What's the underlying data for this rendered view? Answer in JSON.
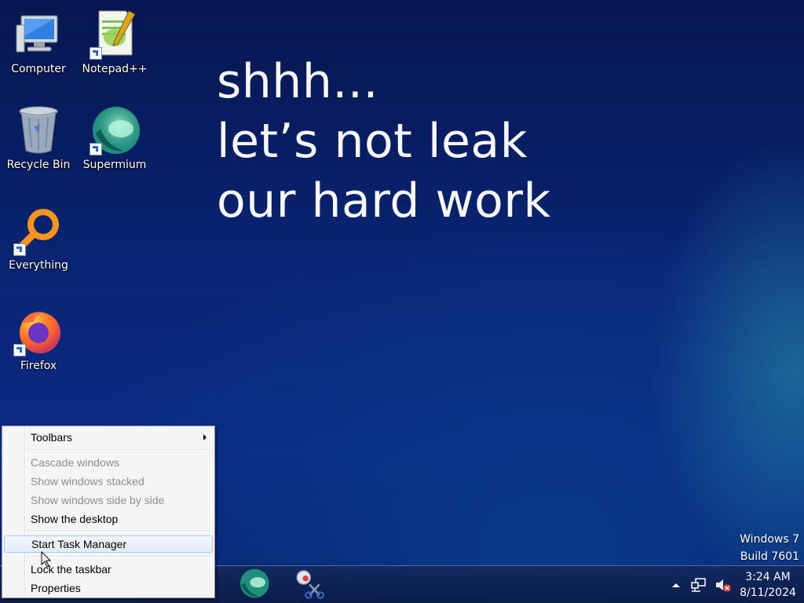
{
  "desktop": {
    "icons": [
      {
        "label": "Computer",
        "icon": "computer-icon",
        "shortcut": false
      },
      {
        "label": "Notepad++",
        "icon": "notepadpp-icon",
        "shortcut": true
      },
      {
        "label": "Recycle Bin",
        "icon": "recycle-bin-icon",
        "shortcut": false
      },
      {
        "label": "Supermium",
        "icon": "supermium-icon",
        "shortcut": true
      },
      {
        "label": "Everything",
        "icon": "everything-search-icon",
        "shortcut": true
      },
      {
        "label": "Firefox",
        "icon": "firefox-icon",
        "shortcut": true
      }
    ],
    "wallpaper_text": {
      "line1": "shhh...",
      "line2": "let’s not leak",
      "line3": "our hard work"
    },
    "watermark": {
      "line1": "Windows 7",
      "line2": "Build 7601"
    }
  },
  "context_menu": {
    "items": [
      {
        "label": "Toolbars",
        "enabled": true,
        "submenu": true
      },
      {
        "label": "Cascade windows",
        "enabled": false
      },
      {
        "label": "Show windows stacked",
        "enabled": false
      },
      {
        "label": "Show windows side by side",
        "enabled": false
      },
      {
        "label": "Show the desktop",
        "enabled": true
      },
      {
        "label": "Start Task Manager",
        "enabled": true,
        "highlighted": true
      },
      {
        "label": "Lock the taskbar",
        "enabled": true,
        "checked": true
      },
      {
        "label": "Properties",
        "enabled": true
      }
    ]
  },
  "taskbar": {
    "pinned": [
      {
        "icon": "supermium-icon"
      },
      {
        "icon": "snipping-tool-icon"
      }
    ],
    "tray": {
      "icons": [
        "show-hidden-icons-chevron-icon",
        "network-icon",
        "volume-muted-icon"
      ],
      "time": "3:24 AM",
      "date": "8/11/2024"
    }
  },
  "colors": {
    "wallpaper_top": "#06164f",
    "wallpaper_bottom": "#0a2a85",
    "menu_background": "#f5f5f5",
    "menu_highlight_border": "#a8c7ef",
    "disabled_text": "#8d8d8d"
  }
}
